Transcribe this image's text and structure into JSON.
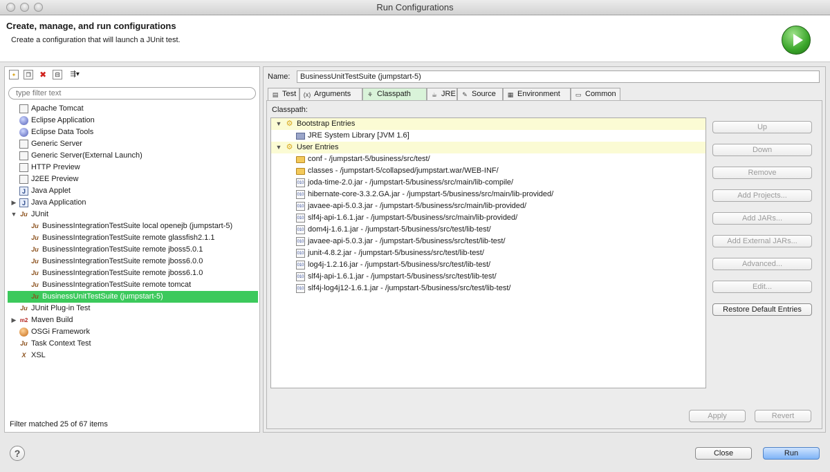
{
  "window": {
    "title": "Run Configurations"
  },
  "header": {
    "title": "Create, manage, and run configurations",
    "subtitle": "Create a configuration that will launch a JUnit test."
  },
  "left": {
    "filter_placeholder": "type filter text",
    "tree": [
      {
        "label": "Apache Tomcat",
        "level": 1,
        "icon": "file-icon"
      },
      {
        "label": "Eclipse Application",
        "level": 1,
        "icon": "globe-icon"
      },
      {
        "label": "Eclipse Data Tools",
        "level": 1,
        "icon": "database-icon"
      },
      {
        "label": "Generic Server",
        "level": 1,
        "icon": "file-icon"
      },
      {
        "label": "Generic Server(External Launch)",
        "level": 1,
        "icon": "file-icon"
      },
      {
        "label": "HTTP Preview",
        "level": 1,
        "icon": "file-icon"
      },
      {
        "label": "J2EE Preview",
        "level": 1,
        "icon": "file-icon"
      },
      {
        "label": "Java Applet",
        "level": 1,
        "icon": "applet-icon"
      },
      {
        "label": "Java Application",
        "level": 1,
        "icon": "java-app-icon",
        "expander": "closed"
      },
      {
        "label": "JUnit",
        "level": 1,
        "icon": "junit-icon",
        "expander": "open"
      },
      {
        "label": "BusinessIntegrationTestSuite local openejb (jumpstart-5)",
        "level": 2,
        "icon": "junit-icon"
      },
      {
        "label": "BusinessIntegrationTestSuite remote glassfish2.1.1",
        "level": 2,
        "icon": "junit-icon"
      },
      {
        "label": "BusinessIntegrationTestSuite remote jboss5.0.1",
        "level": 2,
        "icon": "junit-icon"
      },
      {
        "label": "BusinessIntegrationTestSuite remote jboss6.0.0",
        "level": 2,
        "icon": "junit-icon"
      },
      {
        "label": "BusinessIntegrationTestSuite remote jboss6.1.0",
        "level": 2,
        "icon": "junit-icon"
      },
      {
        "label": "BusinessIntegrationTestSuite remote tomcat",
        "level": 2,
        "icon": "junit-icon"
      },
      {
        "label": "BusinessUnitTestSuite (jumpstart-5)",
        "level": 2,
        "icon": "junit-icon",
        "selected": true
      },
      {
        "label": "JUnit Plug-in Test",
        "level": 1,
        "icon": "junit-icon"
      },
      {
        "label": "Maven Build",
        "level": 1,
        "icon": "maven-icon",
        "expander": "closed"
      },
      {
        "label": "OSGi Framework",
        "level": 1,
        "icon": "osgi-icon"
      },
      {
        "label": "Task Context Test",
        "level": 1,
        "icon": "junit-icon"
      },
      {
        "label": "XSL",
        "level": 1,
        "icon": "xsl-icon"
      }
    ],
    "status": "Filter matched 25 of 67 items"
  },
  "right": {
    "name_label": "Name:",
    "name_value": "BusinessUnitTestSuite (jumpstart-5)",
    "tabs": [
      {
        "label": "Test",
        "icon": "test-icon"
      },
      {
        "label": "Arguments",
        "icon": "arguments-icon"
      },
      {
        "label": "Classpath",
        "icon": "classpath-icon",
        "active": true
      },
      {
        "label": "JRE",
        "icon": "jre-icon"
      },
      {
        "label": "Source",
        "icon": "source-icon"
      },
      {
        "label": "Environment",
        "icon": "environment-icon"
      },
      {
        "label": "Common",
        "icon": "common-icon"
      }
    ],
    "classpath_label": "Classpath:",
    "entries": [
      {
        "label": "Bootstrap Entries",
        "level": 0,
        "type": "group"
      },
      {
        "label": "JRE System Library [JVM 1.6]",
        "level": 1,
        "type": "lib"
      },
      {
        "label": "User Entries",
        "level": 0,
        "type": "group"
      },
      {
        "label": "conf - /jumpstart-5/business/src/test/",
        "level": 1,
        "type": "folder"
      },
      {
        "label": "classes - /jumpstart-5/collapsed/jumpstart.war/WEB-INF/",
        "level": 1,
        "type": "folder"
      },
      {
        "label": "joda-time-2.0.jar - /jumpstart-5/business/src/main/lib-compile/",
        "level": 1,
        "type": "jar"
      },
      {
        "label": "hibernate-core-3.3.2.GA.jar - /jumpstart-5/business/src/main/lib-provided/",
        "level": 1,
        "type": "jar"
      },
      {
        "label": "javaee-api-5.0.3.jar - /jumpstart-5/business/src/main/lib-provided/",
        "level": 1,
        "type": "jar"
      },
      {
        "label": "slf4j-api-1.6.1.jar - /jumpstart-5/business/src/main/lib-provided/",
        "level": 1,
        "type": "jar"
      },
      {
        "label": "dom4j-1.6.1.jar - /jumpstart-5/business/src/test/lib-test/",
        "level": 1,
        "type": "jar"
      },
      {
        "label": "javaee-api-5.0.3.jar - /jumpstart-5/business/src/test/lib-test/",
        "level": 1,
        "type": "jar"
      },
      {
        "label": "junit-4.8.2.jar - /jumpstart-5/business/src/test/lib-test/",
        "level": 1,
        "type": "jar"
      },
      {
        "label": "log4j-1.2.16.jar - /jumpstart-5/business/src/test/lib-test/",
        "level": 1,
        "type": "jar"
      },
      {
        "label": "slf4j-api-1.6.1.jar - /jumpstart-5/business/src/test/lib-test/",
        "level": 1,
        "type": "jar"
      },
      {
        "label": "slf4j-log4j12-1.6.1.jar - /jumpstart-5/business/src/test/lib-test/",
        "level": 1,
        "type": "jar"
      }
    ],
    "side_buttons": {
      "up": "Up",
      "down": "Down",
      "remove": "Remove",
      "add_projects": "Add Projects...",
      "add_jars": "Add JARs...",
      "add_external_jars": "Add External JARs...",
      "advanced": "Advanced...",
      "edit": "Edit...",
      "restore": "Restore Default Entries"
    },
    "apply": "Apply",
    "revert": "Revert"
  },
  "footer": {
    "help": "?",
    "close": "Close",
    "run": "Run"
  }
}
